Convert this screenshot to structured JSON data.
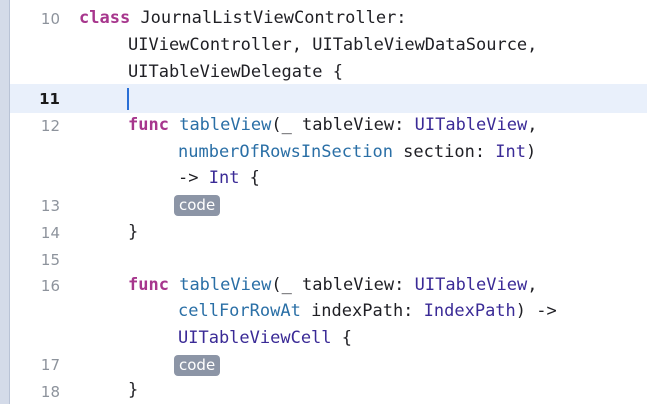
{
  "editor": {
    "line_numbers": [
      "10",
      "11",
      "12",
      "13",
      "14",
      "15",
      "16",
      "17",
      "18"
    ],
    "class_decl": {
      "keyword": "class",
      "name": "JournalListViewController:",
      "protocols_line1": "UIViewController, UITableViewDataSource,",
      "protocols_line2": "UITableViewDelegate {"
    },
    "func1": {
      "keyword": "func",
      "name": "tableView",
      "params_a": "(_ tableView: ",
      "type_a": "UITableView",
      "comma": ",",
      "label_b": "numberOfRowsInSection",
      "params_b": " section: ",
      "type_b": "Int",
      "close_b": ")",
      "arrow": "-> ",
      "return_type": "Int",
      "open_brace": " {",
      "placeholder": "code",
      "close_brace": "}"
    },
    "func2": {
      "keyword": "func",
      "name": "tableView",
      "params_a": "(_ tableView: ",
      "type_a": "UITableView",
      "comma": ",",
      "label_b": "cellForRowAt",
      "params_b": " indexPath: ",
      "type_b": "IndexPath",
      "close_b": ") ->",
      "return_type": "UITableViewCell",
      "open_brace": " {",
      "placeholder": "code",
      "close_brace": "}"
    },
    "colors": {
      "keyword": "#a7368d",
      "type": "#3a2a96",
      "function": "#2a6fa6",
      "current_line": "#e9f0fb",
      "cursor": "#2a6fd6",
      "placeholder_bg": "#8c95a6"
    }
  }
}
